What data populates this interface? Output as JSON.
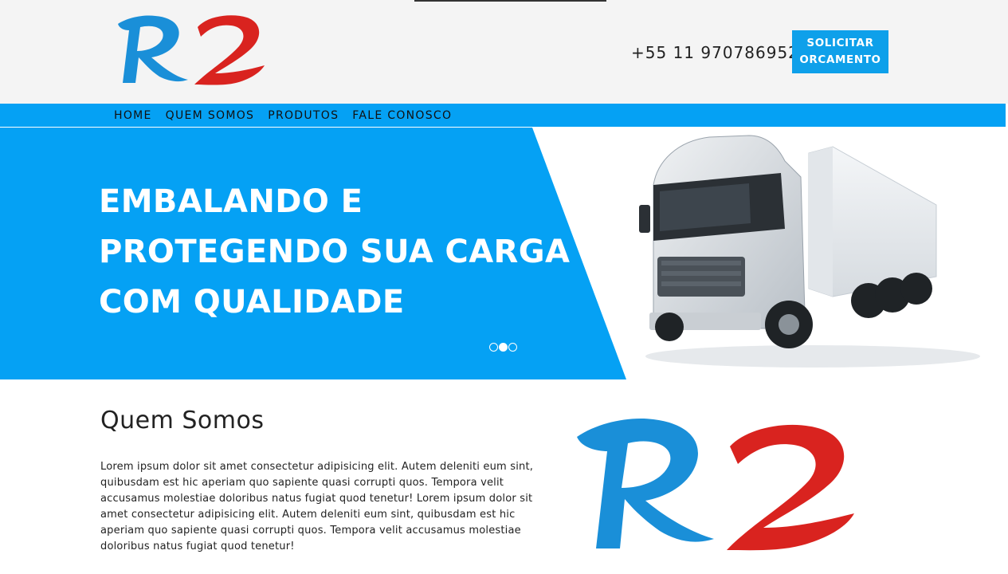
{
  "header": {
    "logo_text": "R2",
    "phone": "+55 11 970786952",
    "cta_label": "SOLICITAR ORCAMENTO",
    "colors": {
      "logo_blue": "#1a8fd8",
      "logo_red": "#d9231f",
      "header_bg": "#f4f4f4"
    }
  },
  "nav": {
    "items": [
      {
        "label": "HOME"
      },
      {
        "label": "QUEM SOMOS"
      },
      {
        "label": "PRODUTOS"
      },
      {
        "label": "FALE CONOSCO"
      }
    ],
    "color": "#05a1f4"
  },
  "hero": {
    "title_lines": [
      "EMBALANDO E",
      "PROTEGENDO SUA CARGA",
      "COM QUALIDADE"
    ],
    "slides": 3,
    "active_slide": 2,
    "image": "truck-image",
    "color": "#05a1f4"
  },
  "about": {
    "title": "Quem Somos",
    "text": "Lorem ipsum dolor sit amet consectetur adipisicing elit. Autem deleniti eum sint, quibusdam est hic aperiam quo sapiente quasi corrupti quos. Tempora velit accusamus molestiae doloribus natus fugiat quod tenetur! Lorem ipsum dolor sit amet consectetur adipisicing elit. Autem deleniti eum sint, quibusdam est hic aperiam quo sapiente quasi corrupti quos. Tempora velit accusamus molestiae doloribus natus fugiat quod tenetur!",
    "logo_text": "R2"
  }
}
